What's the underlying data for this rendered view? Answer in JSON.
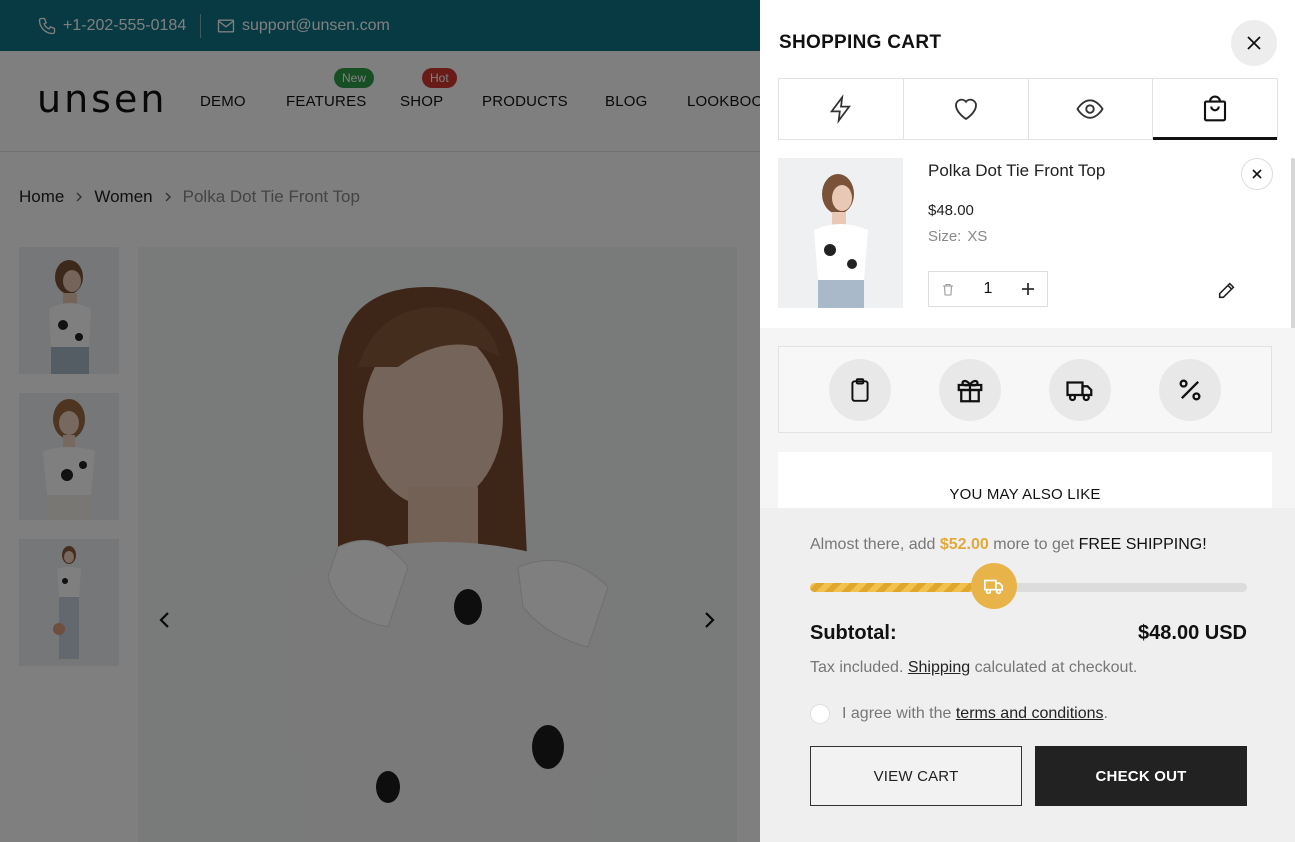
{
  "topbar": {
    "phone": "+1-202-555-0184",
    "email": "support@unsen.com",
    "bg_color": "#0f7585"
  },
  "header": {
    "logo": "unsen",
    "nav": [
      {
        "label": "DEMO"
      },
      {
        "label": "FEATURES",
        "badge": "New",
        "badge_color": "#2e9d48"
      },
      {
        "label": "SHOP",
        "badge": "Hot",
        "badge_color": "#d2382f"
      },
      {
        "label": "PRODUCTS"
      },
      {
        "label": "BLOG"
      },
      {
        "label": "LOOKBOOK"
      }
    ]
  },
  "breadcrumb": [
    "Home",
    "Women",
    "Polka Dot Tie Front Top"
  ],
  "gallery": {
    "thumbnails": 3,
    "prev_icon": "chevron-left-icon",
    "next_icon": "chevron-right-icon"
  },
  "cart": {
    "title": "SHOPPING CART",
    "tabs": [
      {
        "icon": "lightning-icon",
        "active": false
      },
      {
        "icon": "heart-icon",
        "active": false
      },
      {
        "icon": "eye-icon",
        "active": false
      },
      {
        "icon": "shopping-bag-icon",
        "active": true
      }
    ],
    "item": {
      "name": "Polka Dot Tie Front Top",
      "price": "$48.00",
      "size_label": "Size:",
      "size_value": "XS",
      "quantity": "1"
    },
    "tools": [
      "clipboard-icon",
      "gift-icon",
      "truck-icon",
      "percent-icon"
    ],
    "also_like": "YOU MAY ALSO LIKE",
    "shipping": {
      "pre": "Almost there, add",
      "amount": "$52.00",
      "mid": "more to get",
      "goal": "FREE SHIPPING!",
      "progress_pct": 42,
      "accent": "#e8b44a"
    },
    "subtotal_label": "Subtotal:",
    "subtotal_value": "$48.00 USD",
    "tax": {
      "pre": "Tax included.",
      "link": "Shipping",
      "post": "calculated at checkout."
    },
    "agree": {
      "pre": "I agree with the",
      "link": "terms and conditions",
      "post": "."
    },
    "view_cart": "VIEW CART",
    "checkout": "CHECK OUT"
  }
}
